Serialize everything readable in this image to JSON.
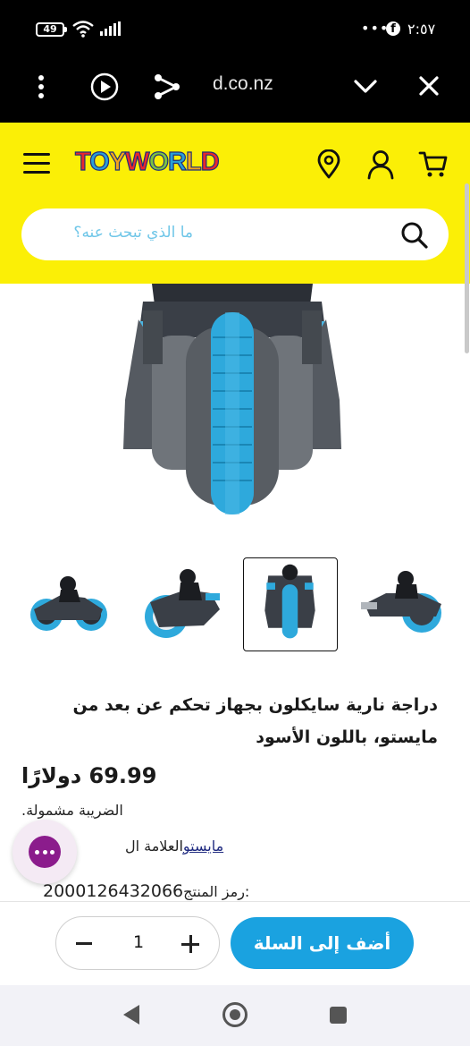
{
  "status_bar": {
    "battery": "49",
    "time": "٢:٥٧",
    "more": "•••",
    "notification_app": "f"
  },
  "browser": {
    "url": "d.co.nz"
  },
  "header": {
    "logo_letters": [
      "T",
      "O",
      "Y",
      "W",
      "O",
      "R",
      "L",
      "D"
    ],
    "search_placeholder": "ما الذي تبحث عنه؟"
  },
  "product": {
    "title": "دراجة نارية سايكلون بجهاز تحكم عن بعد من مايستو، باللون الأسود",
    "price": "69.99 دولارًا",
    "tax_note": "الضريبة مشمولة.",
    "brand_label": "العلامة ال",
    "brand_value": "مايستو",
    "sku_label": "رمز المنتج:",
    "sku_value": "2000126432066",
    "thumbnails": [
      "thumb-1",
      "thumb-2",
      "thumb-3",
      "thumb-4"
    ],
    "selected_thumbnail": 3
  },
  "cart": {
    "quantity": "1",
    "add_to_cart_label": "أضف إلى السلة"
  },
  "colors": {
    "header_bg": "#fbef06",
    "accent": "#1aa2e0",
    "chat": "#8b1c8c"
  }
}
